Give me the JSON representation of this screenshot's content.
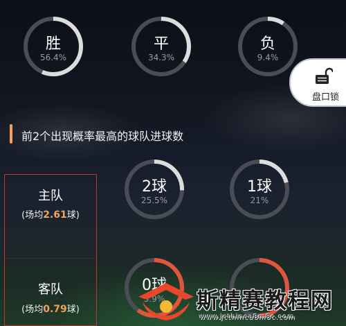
{
  "outcome_rings": [
    {
      "label": "胜",
      "pct": "56.4%",
      "fraction": 0.564,
      "color": "#dcdcdc"
    },
    {
      "label": "平",
      "pct": "34.3%",
      "fraction": 0.343,
      "color": "#dcdcdc"
    },
    {
      "label": "负",
      "pct": "9.4%",
      "fraction": 0.094,
      "color": "#dcdcdc"
    }
  ],
  "lock": {
    "label": "盘口锁",
    "icon": "unlocked-padlock-icon"
  },
  "section": {
    "title": "前2个出现概率最高的球队进球数",
    "accent": "#f0a35a"
  },
  "home": {
    "name": "主队",
    "avg_prefix": "(场均",
    "avg_value": "2.61",
    "avg_suffix": "球)",
    "rings": [
      {
        "label": "2球",
        "pct": "25.5%",
        "fraction": 0.255,
        "color": "#dcdcdc"
      },
      {
        "label": "1球",
        "pct": "21%",
        "fraction": 0.21,
        "color": "#dcdcdc"
      }
    ]
  },
  "away": {
    "name": "客队",
    "avg_prefix": "(场均",
    "avg_value": "0.79",
    "avg_suffix": "球)",
    "rings": [
      {
        "label": "0球",
        "pct": "5.9%",
        "fraction": 0.6,
        "color": "#e0553d"
      },
      {
        "label": "",
        "pct": "",
        "fraction": 0.5,
        "color": "#e0553d"
      }
    ]
  },
  "watermark": {
    "text": "斯精赛教程网",
    "url": "www.jcthinca8m8c.com"
  },
  "colors": {
    "highlight": "#f0a35a",
    "box_border": "#c0392b",
    "track": "#4a4d55"
  }
}
